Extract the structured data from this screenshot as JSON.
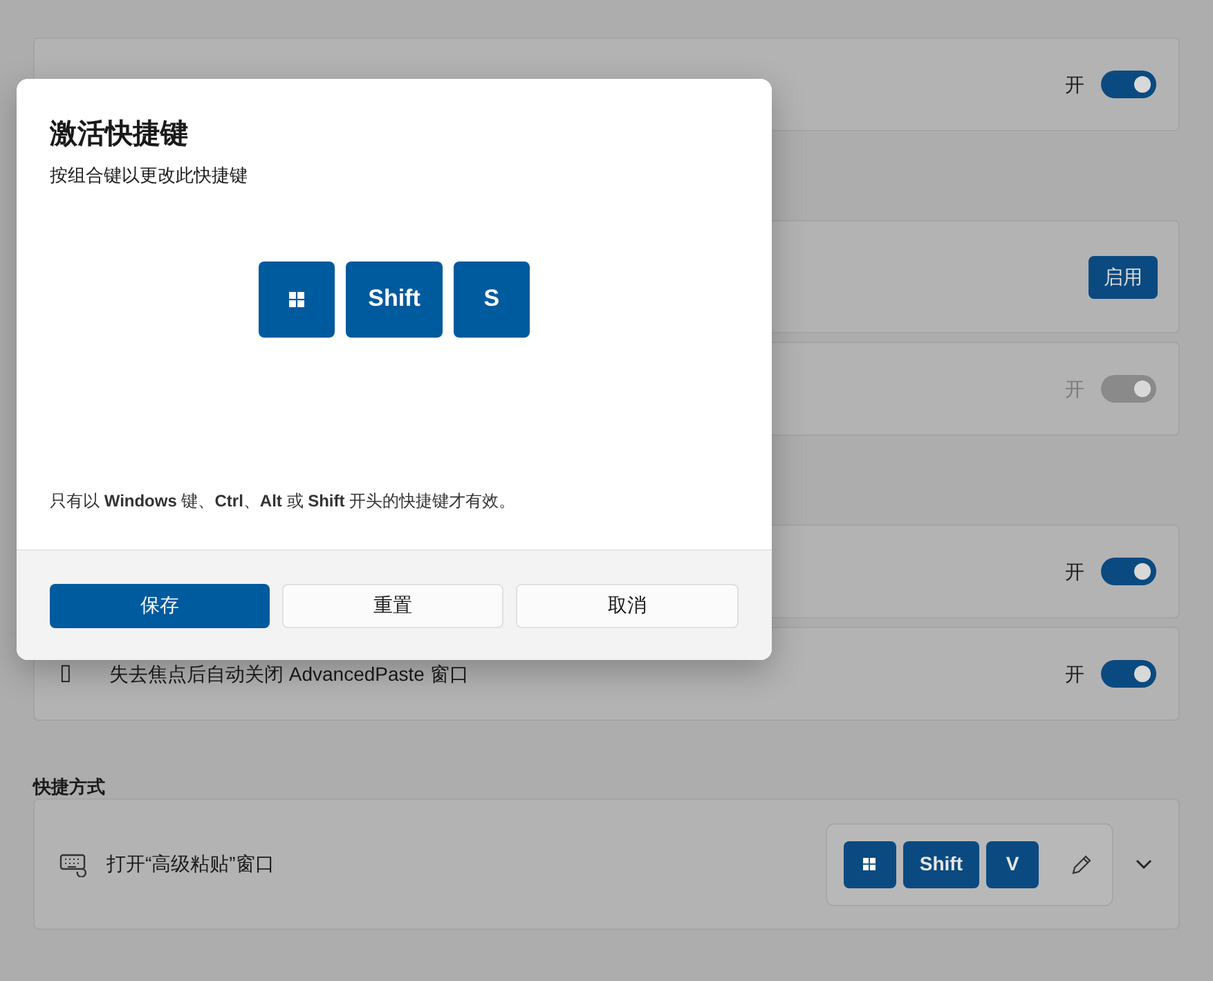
{
  "groups": [
    [
      {
        "kind": "toggle",
        "state_text": "开",
        "on": true,
        "disabled": false
      }
    ],
    [
      {
        "kind": "button",
        "button": "启用"
      },
      {
        "kind": "toggle",
        "state_text": "开",
        "on": true,
        "disabled": true
      }
    ],
    [
      {
        "kind": "toggle",
        "state_text": "开",
        "on": true,
        "disabled": false
      },
      {
        "kind": "toggle",
        "icon": "▯",
        "label": "失去焦点后自动关闭 AdvancedPaste 窗口",
        "state_text": "开",
        "on": true,
        "disabled": false
      }
    ]
  ],
  "shortcut_section": {
    "title": "快捷方式",
    "label": "打开“高级粘贴”窗口",
    "keys": [
      {
        "kind": "win"
      },
      {
        "kind": "text",
        "label": "Shift"
      },
      {
        "kind": "text",
        "label": "V"
      }
    ]
  },
  "dialog": {
    "title": "激活快捷键",
    "subtitle": "按组合键以更改此快捷键",
    "keys": [
      {
        "kind": "win"
      },
      {
        "kind": "text",
        "label": "Shift"
      },
      {
        "kind": "text",
        "label": "S"
      }
    ],
    "note": "只有以 **Windows** 键、**Ctrl**、**Alt** 或 **Shift** 开头的快捷键才有效。",
    "buttons": [
      {
        "label": "保存",
        "primary": true
      },
      {
        "label": "重置",
        "primary": false
      },
      {
        "label": "取消",
        "primary": false
      }
    ]
  }
}
